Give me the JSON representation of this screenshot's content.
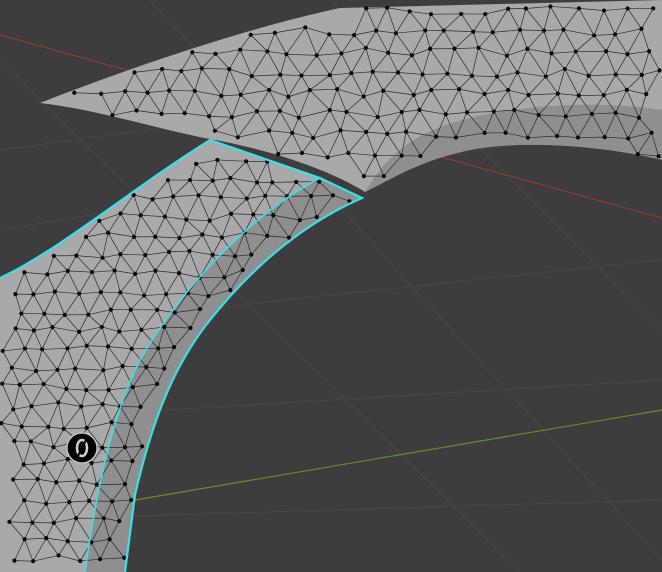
{
  "viewport": {
    "background": "#3d3d3d",
    "grid_color": "#474747",
    "x_axis_color": "#8a3b3d",
    "y_axis_color": "#6b8a28",
    "mesh_face_color": "#a9a9a9",
    "mesh_shade_color": "#8f8f8f",
    "wire_color": "#2a2a2a",
    "vertex_color": "#0a0a0a",
    "selection_outline_color": "#39e0e8"
  },
  "overlay": {
    "origin_icon": "origin-marker-icon"
  }
}
